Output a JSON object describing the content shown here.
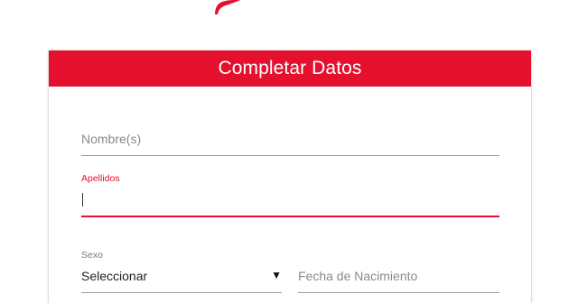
{
  "form": {
    "title": "Completar Datos",
    "nombre": {
      "placeholder": "Nombre(s)"
    },
    "apellidos": {
      "label": "Apellidos",
      "value": ""
    },
    "sexo": {
      "label": "Sexo",
      "selected": "Seleccionar"
    },
    "fecha": {
      "placeholder": "Fecha de Nacimiento"
    }
  },
  "colors": {
    "accent": "#e4102e",
    "header_text": "#ffffff"
  },
  "icons": {
    "logo": "brand-logo-icon",
    "dropdown": "dropdown-arrow-icon"
  }
}
